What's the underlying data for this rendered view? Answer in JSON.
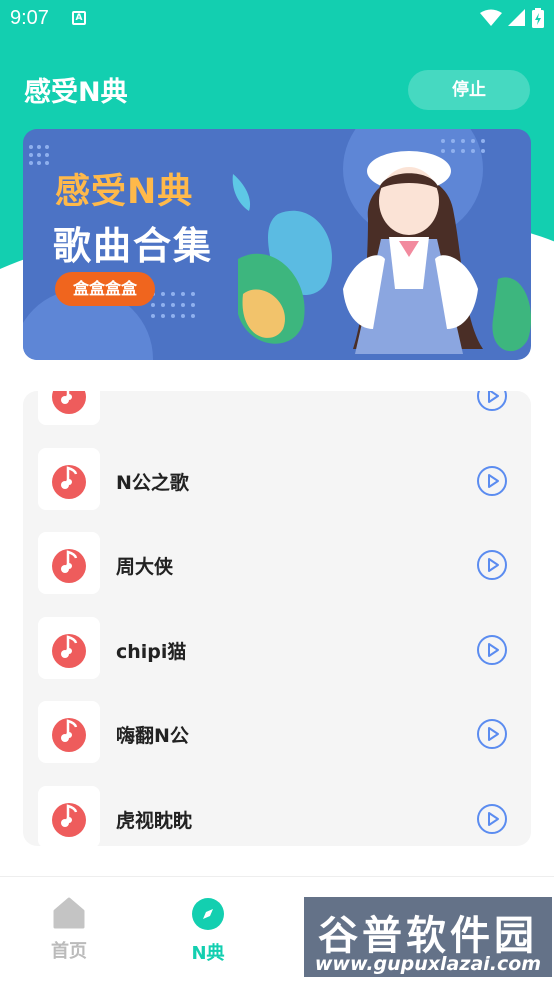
{
  "status_bar": {
    "time": "9:07",
    "notification_badge": "A"
  },
  "header": {
    "title": "感受N典",
    "stop_label": "停止"
  },
  "banner": {
    "title_line1": "感受N典",
    "title_line2": "歌曲合集",
    "tag": "盒盒盒盒"
  },
  "songs": [
    {
      "name": ""
    },
    {
      "name": "N公之歌"
    },
    {
      "name": "周大侠"
    },
    {
      "name": "chipi猫"
    },
    {
      "name": "嗨翻N公"
    },
    {
      "name": "虎视眈眈"
    }
  ],
  "bottom_nav": {
    "items": [
      {
        "label": "首页",
        "icon": "home-icon",
        "active": false
      },
      {
        "label": "N典",
        "icon": "compass-icon",
        "active": true
      }
    ]
  },
  "watermark": {
    "title": "谷普软件园",
    "url": "www.gupuxlazai.com"
  },
  "colors": {
    "accent": "#13CFB0",
    "banner_bg": "#4C73C5",
    "music_icon": "#EE5C5C",
    "play_icon": "#5B8CF0",
    "nav_inactive": "#BBBBBB"
  }
}
